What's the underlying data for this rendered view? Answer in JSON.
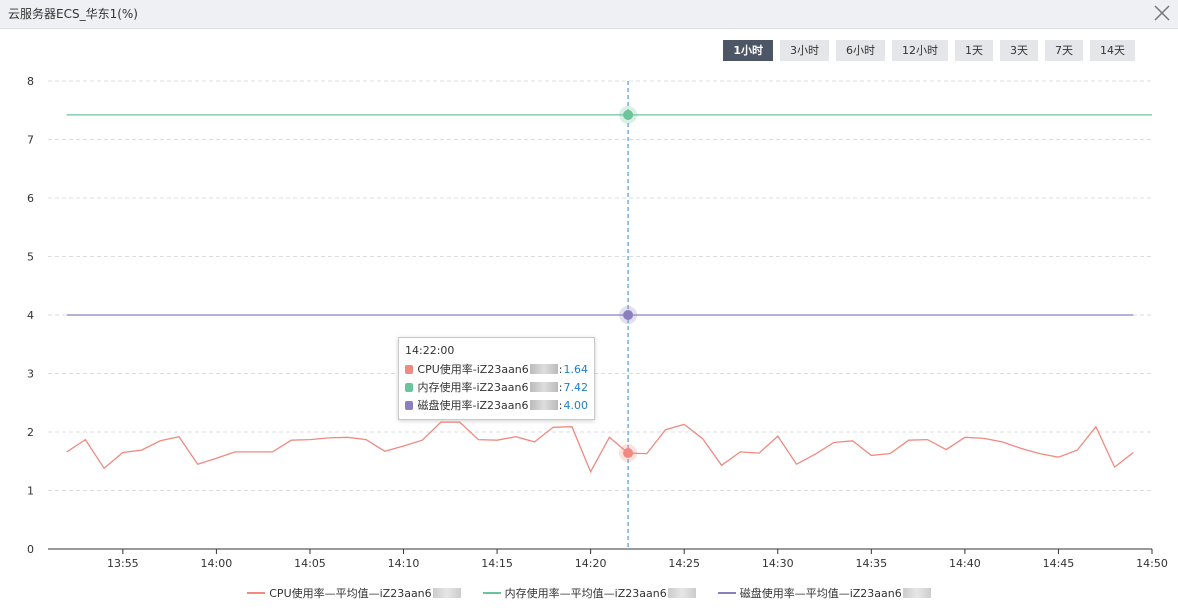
{
  "window": {
    "title": "云服务器ECS_华东1(%)"
  },
  "time_ranges": {
    "items": [
      "1小时",
      "3小时",
      "6小时",
      "12小时",
      "1天",
      "3天",
      "7天",
      "14天"
    ],
    "active_index": 0
  },
  "colors": {
    "cpu": "#f08a80",
    "memory": "#6cc49a",
    "disk": "#8c7fbe",
    "crosshair": "#2e86d1",
    "grid": "#dcdcdc"
  },
  "tooltip": {
    "time": "14:22:00",
    "rows": [
      {
        "name": "CPU使用率-iZ23aan6",
        "value": "1.64",
        "color": "#f08a80"
      },
      {
        "name": "内存使用率-iZ23aan6",
        "value": "7.42",
        "color": "#6cc49a"
      },
      {
        "name": "磁盘使用率-iZ23aan6",
        "value": "4.00",
        "color": "#8c7fbe"
      }
    ]
  },
  "legend": [
    {
      "label": "CPU使用率—平均值—iZ23aan6",
      "color": "#f08a80"
    },
    {
      "label": "内存使用率—平均值—iZ23aan6",
      "color": "#6cc49a"
    },
    {
      "label": "磁盘使用率—平均值—iZ23aan6",
      "color": "#8c7fbe"
    }
  ],
  "chart_data": {
    "type": "line",
    "ylim": [
      0,
      8
    ],
    "yticks": [
      0,
      1,
      2,
      3,
      4,
      5,
      6,
      7,
      8
    ],
    "xlim": [
      "13:51",
      "14:50"
    ],
    "xticks": [
      "13:55",
      "14:00",
      "14:05",
      "14:10",
      "14:15",
      "14:20",
      "14:25",
      "14:30",
      "14:35",
      "14:40",
      "14:45",
      "14:50"
    ],
    "grid": true,
    "legend_position": "bottom",
    "crosshair_x": "14:22",
    "series": [
      {
        "name": "CPU使用率—平均值—iZ23aan6",
        "x": [
          "13:52",
          "13:53",
          "13:54",
          "13:55",
          "13:56",
          "13:57",
          "13:58",
          "13:59",
          "14:00",
          "14:01",
          "14:02",
          "14:03",
          "14:04",
          "14:05",
          "14:06",
          "14:07",
          "14:08",
          "14:09",
          "14:10",
          "14:11",
          "14:12",
          "14:13",
          "14:14",
          "14:15",
          "14:16",
          "14:17",
          "14:18",
          "14:19",
          "14:20",
          "14:21",
          "14:22",
          "14:23",
          "14:24",
          "14:25",
          "14:26",
          "14:27",
          "14:28",
          "14:29",
          "14:30",
          "14:31",
          "14:32",
          "14:33",
          "14:34",
          "14:35",
          "14:36",
          "14:37",
          "14:38",
          "14:39",
          "14:40",
          "14:41",
          "14:42",
          "14:43",
          "14:44",
          "14:45",
          "14:46",
          "14:47",
          "14:48",
          "14:49"
        ],
        "values": [
          1.66,
          1.87,
          1.38,
          1.65,
          1.69,
          1.85,
          1.92,
          1.45,
          1.55,
          1.66,
          1.66,
          1.66,
          1.86,
          1.87,
          1.9,
          1.91,
          1.87,
          1.67,
          1.76,
          1.86,
          2.17,
          2.17,
          1.87,
          1.86,
          1.92,
          1.83,
          2.08,
          2.09,
          1.32,
          1.91,
          1.64,
          1.63,
          2.04,
          2.13,
          1.88,
          1.43,
          1.66,
          1.64,
          1.93,
          1.45,
          1.62,
          1.82,
          1.85,
          1.6,
          1.63,
          1.86,
          1.87,
          1.7,
          1.91,
          1.89,
          1.83,
          1.72,
          1.63,
          1.57,
          1.69,
          2.09,
          1.4,
          1.65
        ]
      },
      {
        "name": "内存使用率—平均值—iZ23aan6",
        "x": [
          "13:52",
          "14:22",
          "14:50"
        ],
        "values": [
          7.42,
          7.42,
          7.42
        ]
      },
      {
        "name": "磁盘使用率—平均值—iZ23aan6",
        "x": [
          "13:52",
          "14:22",
          "14:49"
        ],
        "values": [
          4.0,
          4.0,
          4.0
        ]
      }
    ]
  }
}
